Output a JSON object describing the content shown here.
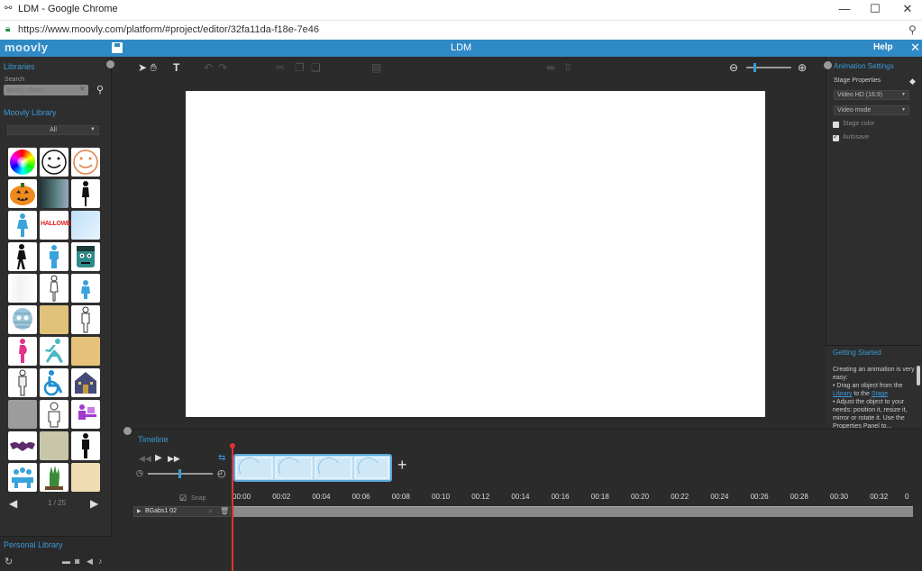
{
  "browser": {
    "title": "LDM - Google Chrome",
    "url": "https://www.moovly.com/platform/#project/editor/32fa11da-f18e-7e46"
  },
  "app": {
    "logo": "moovly",
    "title": "LDM",
    "help_label": "Help",
    "accent": "#2f89c5"
  },
  "libraries": {
    "title": "Libraries",
    "search_label": "Search",
    "search_placeholder": "library, object, ...",
    "library_title": "Moovly Library",
    "filter_value": "All",
    "pager_text": "1 / 25",
    "personal_title": "Personal Library"
  },
  "animation_settings": {
    "title": "Animation Settings",
    "stage_properties": "Stage Properties",
    "format_value": "Video HD (16:9)",
    "mode_value": "Video mode",
    "stage_color_label": "Stage color",
    "autosave_label": "Autosave"
  },
  "getting_started": {
    "title": "Getting Started",
    "intro": "Creating an animation is very easy:",
    "step1_a": "Drag an object from the",
    "step1_link1": "Library",
    "step1_b": "to the",
    "step1_link2": "Stage",
    "step2": "Adjust the object to your needs: position it, resize it, mirror or rotate it. Use the Properties Panel to..."
  },
  "timeline": {
    "title": "Timeline",
    "snap_label": "Snap",
    "row_label": "BGabs1 02",
    "markers": [
      "00:00",
      "00:02",
      "00:04",
      "00:06",
      "00:08",
      "00:10",
      "00:12",
      "00:14",
      "00:16",
      "00:18",
      "00:20",
      "00:22",
      "00:24",
      "00:26",
      "00:28",
      "00:30",
      "00:32"
    ],
    "add_label": "+"
  }
}
